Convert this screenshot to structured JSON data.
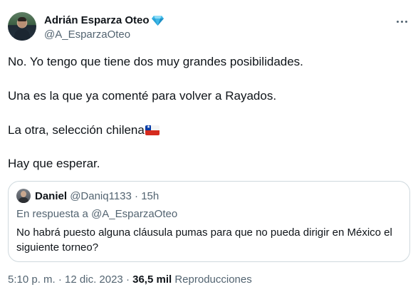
{
  "author": {
    "display_name": "Adrián Esparza Oteo",
    "handle": "@A_EsparzaOteo",
    "verified_icon": "diamond-badge-icon"
  },
  "tweet": {
    "line1": "No. Yo tengo que tiene dos muy grandes posibilidades.",
    "line2": "Una es la que ya comenté para volver a Rayados.",
    "line3": "La otra, selección chilena",
    "line3_emoji": "chile-flag-icon",
    "line4": "Hay que esperar."
  },
  "quoted": {
    "name": "Daniel",
    "handle": "@Daniq1133",
    "separator": " · ",
    "time": "15h",
    "reply_to": "En respuesta a @A_EsparzaOteo",
    "text": "No habrá puesto alguna cláusula pumas para que no pueda dirigir en México el siguiente torneo?"
  },
  "footer": {
    "time": "5:10 p. m.",
    "separator": " · ",
    "date": "12 dic. 2023",
    "views": "36,5 mil",
    "views_label": "Reproducciones"
  },
  "colors": {
    "text": "#0f1419",
    "secondary": "#536471",
    "border": "#cfd9de",
    "verified": "#3fb8e8"
  }
}
